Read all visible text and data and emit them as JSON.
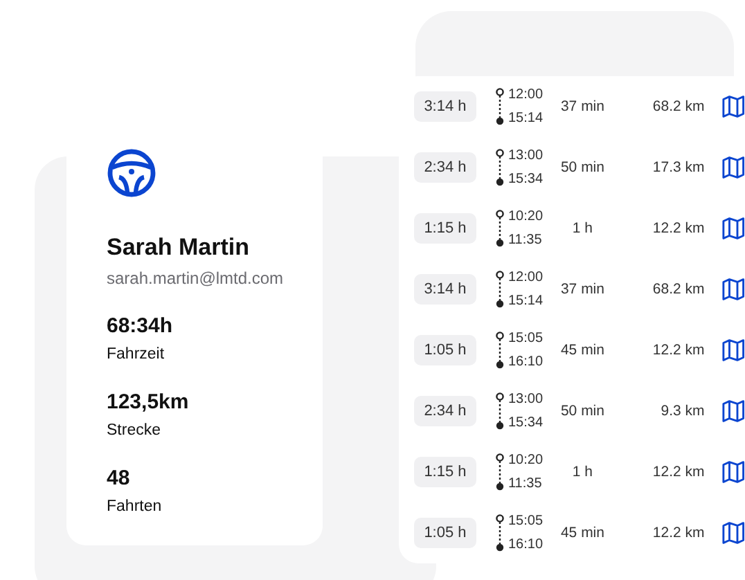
{
  "profile": {
    "name": "Sarah Martin",
    "email": "sarah.martin@lmtd.com",
    "stats": [
      {
        "value": "68:34h",
        "label": "Fahrzeit"
      },
      {
        "value": "123,5km",
        "label": "Strecke"
      },
      {
        "value": "48",
        "label": "Fahrten"
      }
    ]
  },
  "trips": [
    {
      "duration": "3:14 h",
      "start": "12:00",
      "end": "15:14",
      "column_4": "37 min",
      "distance": "68.2 km"
    },
    {
      "duration": "2:34 h",
      "start": "13:00",
      "end": "15:34",
      "column_4": "50 min",
      "distance": "17.3 km"
    },
    {
      "duration": "1:15 h",
      "start": "10:20",
      "end": "11:35",
      "column_4": "1 h",
      "distance": "12.2 km"
    },
    {
      "duration": "3:14 h",
      "start": "12:00",
      "end": "15:14",
      "column_4": "37 min",
      "distance": "68.2 km"
    },
    {
      "duration": "1:05 h",
      "start": "15:05",
      "end": "16:10",
      "column_4": "45 min",
      "distance": "12.2 km"
    },
    {
      "duration": "2:34 h",
      "start": "13:00",
      "end": "15:34",
      "column_4": "50 min",
      "distance": "9.3 km"
    },
    {
      "duration": "1:15 h",
      "start": "10:20",
      "end": "11:35",
      "column_4": "1 h",
      "distance": "12.2 km"
    },
    {
      "duration": "1:05 h",
      "start": "15:05",
      "end": "16:10",
      "column_4": "45 min",
      "distance": "12.2 km"
    }
  ]
}
